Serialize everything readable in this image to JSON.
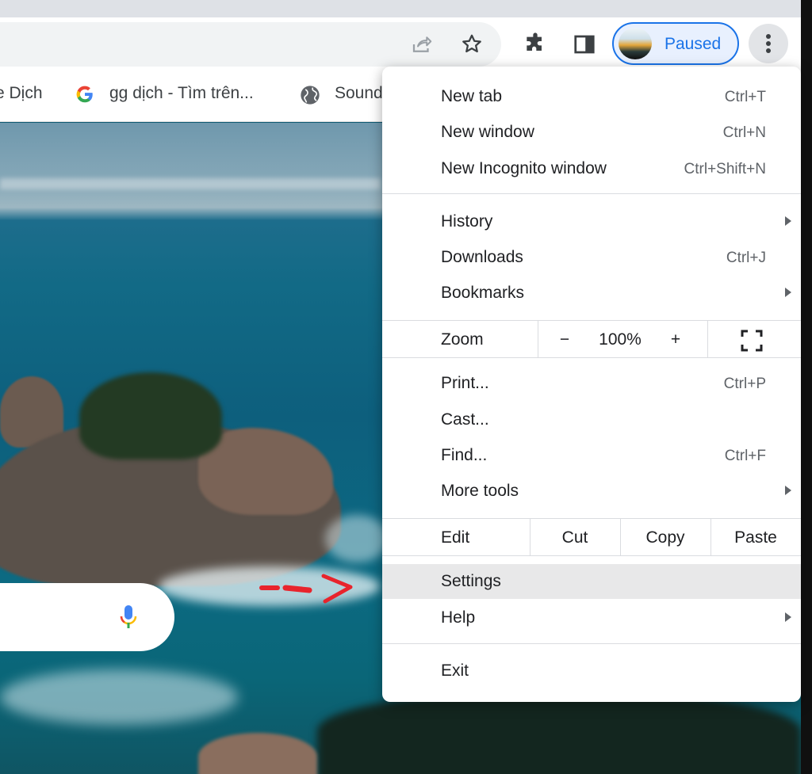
{
  "toolbar": {
    "profile_label": "Paused"
  },
  "bookmarks": [
    {
      "label": "e Dịch",
      "icon": "none"
    },
    {
      "label": "gg dịch - Tìm trên...",
      "icon": "google-icon"
    },
    {
      "label": "Sound",
      "icon": "globe-icon"
    }
  ],
  "menu": {
    "new_tab": {
      "label": "New tab",
      "shortcut": "Ctrl+T"
    },
    "new_window": {
      "label": "New window",
      "shortcut": "Ctrl+N"
    },
    "new_incognito": {
      "label": "New Incognito window",
      "shortcut": "Ctrl+Shift+N"
    },
    "history": {
      "label": "History"
    },
    "downloads": {
      "label": "Downloads",
      "shortcut": "Ctrl+J"
    },
    "bookmarks": {
      "label": "Bookmarks"
    },
    "zoom": {
      "label": "Zoom",
      "minus": "−",
      "level": "100%",
      "plus": "+"
    },
    "print": {
      "label": "Print...",
      "shortcut": "Ctrl+P"
    },
    "cast": {
      "label": "Cast..."
    },
    "find": {
      "label": "Find...",
      "shortcut": "Ctrl+F"
    },
    "more_tools": {
      "label": "More tools"
    },
    "edit": {
      "label": "Edit",
      "cut": "Cut",
      "copy": "Copy",
      "paste": "Paste"
    },
    "settings": {
      "label": "Settings"
    },
    "help": {
      "label": "Help"
    },
    "exit": {
      "label": "Exit"
    }
  },
  "colors": {
    "accent": "#1a73e8",
    "menu_highlight": "#e8e8e9",
    "annotation": "#e8242c"
  }
}
